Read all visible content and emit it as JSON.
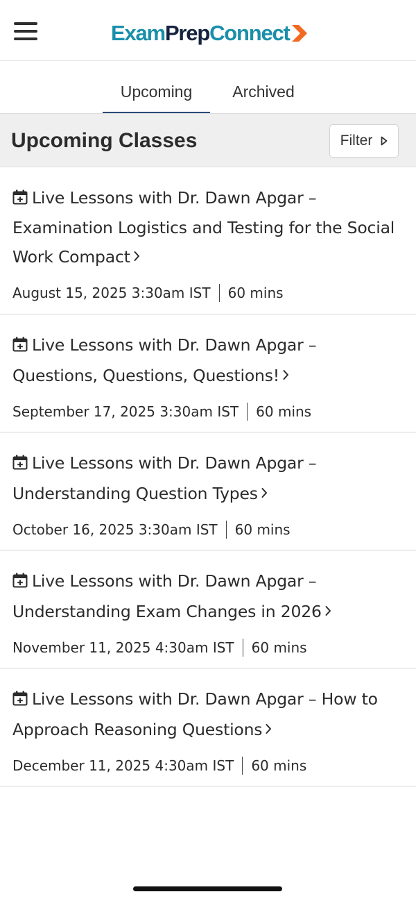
{
  "header": {
    "logo": {
      "part_a": "Exam",
      "part_b": "Prep",
      "part_c": "Connect"
    },
    "menu_icon": "hamburger-icon",
    "brand_colors": {
      "teal": "#1a8faa",
      "navy": "#15233f",
      "orange": "#f26a21"
    }
  },
  "tabs": [
    {
      "label": "Upcoming",
      "active": true
    },
    {
      "label": "Archived",
      "active": false
    }
  ],
  "section": {
    "title": "Upcoming Classes",
    "filter_label": "Filter",
    "filter_icon": "caret-right-icon"
  },
  "classes": [
    {
      "title": "Live Lessons with Dr. Dawn Apgar – Examination Logistics and Testing for the Social Work Compact",
      "date": "August 15, 2025 3:30am IST",
      "duration": "60 mins"
    },
    {
      "title": "Live Lessons with Dr. Dawn Apgar – Questions, Questions, Questions!",
      "date": "September 17, 2025 3:30am IST",
      "duration": "60 mins"
    },
    {
      "title": "Live Lessons with Dr. Dawn Apgar – Understanding Question Types",
      "date": "October 16, 2025 3:30am IST",
      "duration": "60 mins"
    },
    {
      "title": "Live Lessons with Dr. Dawn Apgar – Understanding Exam Changes in 2026",
      "date": "November 11, 2025 4:30am IST",
      "duration": "60 mins"
    },
    {
      "title": "Live Lessons with Dr. Dawn Apgar – How to Approach Reasoning Questions",
      "date": "December 11, 2025 4:30am IST",
      "duration": "60 mins"
    }
  ]
}
